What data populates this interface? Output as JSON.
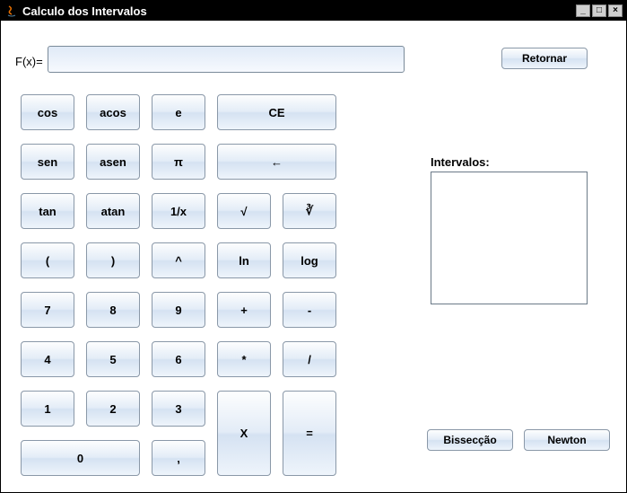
{
  "window": {
    "title": "Calculo dos Intervalos"
  },
  "fx": {
    "label": "F(x)=",
    "value": ""
  },
  "buttons": {
    "retornar": "Retornar",
    "bisseccao": "Bissecção",
    "newton": "Newton"
  },
  "intervalos": {
    "label": "Intervalos:"
  },
  "keys": {
    "cos": "cos",
    "acos": "acos",
    "e": "e",
    "ce": "CE",
    "sen": "sen",
    "asen": "asen",
    "pi": "π",
    "back": "←",
    "tan": "tan",
    "atan": "atan",
    "inv": "1/x",
    "sqrt": "√",
    "cbrt": "∛",
    "lparen": "(",
    "rparen": ")",
    "pow": "^",
    "ln": "ln",
    "log": "log",
    "7": "7",
    "8": "8",
    "9": "9",
    "plus": "+",
    "minus": "-",
    "4": "4",
    "5": "5",
    "6": "6",
    "mul": "*",
    "div": "/",
    "1": "1",
    "2": "2",
    "3": "3",
    "x": "X",
    "eq": "=",
    "0": "0",
    "comma": ","
  }
}
